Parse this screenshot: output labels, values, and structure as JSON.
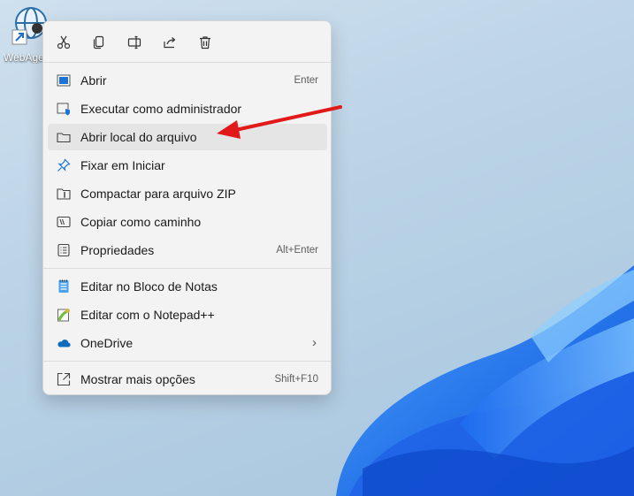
{
  "desktop": {
    "icon_label": "WebAgent"
  },
  "toolbar": {
    "buttons": [
      {
        "icon": "cut-icon"
      },
      {
        "icon": "copy-icon"
      },
      {
        "icon": "rename-icon"
      },
      {
        "icon": "share-icon"
      },
      {
        "icon": "delete-icon"
      }
    ]
  },
  "menu": {
    "items": [
      {
        "label": "Abrir",
        "shortcut": "Enter",
        "icon": "open-icon"
      },
      {
        "label": "Executar como administrador",
        "shortcut": "",
        "icon": "run-as-admin-icon"
      },
      {
        "label": "Abrir local do arquivo",
        "shortcut": "",
        "icon": "folder-icon",
        "highlighted": true
      },
      {
        "label": "Fixar em Iniciar",
        "shortcut": "",
        "icon": "pin-icon"
      },
      {
        "label": "Compactar para arquivo ZIP",
        "shortcut": "",
        "icon": "zip-icon"
      },
      {
        "label": "Copiar como caminho",
        "shortcut": "",
        "icon": "copy-path-icon"
      },
      {
        "label": "Propriedades",
        "shortcut": "Alt+Enter",
        "icon": "properties-icon"
      },
      {
        "label": "Editar no Bloco de Notas",
        "shortcut": "",
        "icon": "notepad-icon"
      },
      {
        "label": "Editar com o Notepad++",
        "shortcut": "",
        "icon": "notepadplusplus-icon"
      },
      {
        "label": "OneDrive",
        "shortcut": "",
        "icon": "onedrive-icon",
        "submenu": true
      },
      {
        "label": "Mostrar mais opções",
        "shortcut": "Shift+F10",
        "icon": "more-options-icon"
      }
    ]
  },
  "colors": {
    "accent": "#0067c0",
    "arrow": "#e11919",
    "menu_bg": "#f3f3f3",
    "highlight": "#e5e5e5"
  }
}
